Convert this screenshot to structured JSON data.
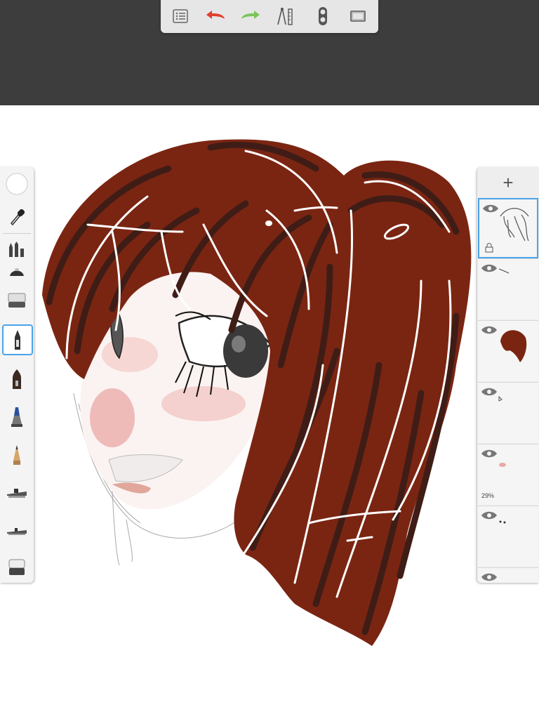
{
  "app": {
    "top_bar_color": "#3d3d3d",
    "toolbar_color": "#e6e6e6",
    "accent": "#4aa3e8"
  },
  "toolbar": {
    "items": [
      {
        "name": "menu-icon",
        "color": "#555555"
      },
      {
        "name": "undo-icon",
        "color": "#e04030"
      },
      {
        "name": "redo-icon",
        "color": "#7bc45a"
      },
      {
        "name": "ruler-icon",
        "color": "#555555"
      },
      {
        "name": "layers-toggle-icon",
        "color": "#555555"
      },
      {
        "name": "fullscreen-icon",
        "color": "#555555"
      }
    ]
  },
  "brush_panel": {
    "tools": [
      {
        "name": "color-swatch",
        "color": "#ffffff"
      },
      {
        "name": "eyedropper-icon"
      },
      {
        "name": "brush-properties-icon"
      },
      {
        "name": "smudge-icon"
      },
      {
        "name": "eraser-soft-icon"
      },
      {
        "name": "ballpoint-pen-icon",
        "selected": true
      },
      {
        "name": "pen-icon"
      },
      {
        "name": "marker-icon"
      },
      {
        "name": "pencil-icon"
      },
      {
        "name": "airbrush-icon"
      },
      {
        "name": "airbrush-fine-icon"
      },
      {
        "name": "eraser-icon"
      }
    ]
  },
  "layers": {
    "add_label": "+",
    "items": [
      {
        "name": "layer-hair-lines",
        "selected": true,
        "locked": true,
        "opacity_label": ""
      },
      {
        "name": "layer-lines",
        "selected": false,
        "opacity_label": ""
      },
      {
        "name": "layer-hair-color",
        "selected": false,
        "opacity_label": ""
      },
      {
        "name": "layer-eye",
        "selected": false,
        "opacity_label": ""
      },
      {
        "name": "layer-blush",
        "selected": false,
        "opacity_label": "29%"
      },
      {
        "name": "layer-details",
        "selected": false,
        "opacity_label": ""
      }
    ]
  },
  "artwork": {
    "hair_color": "#7a2512",
    "hair_shadow": "#3f1d16",
    "skin_blush": "#e9a8a5",
    "eye_color": "#333333",
    "sketch_line": "#9a9a9a"
  }
}
